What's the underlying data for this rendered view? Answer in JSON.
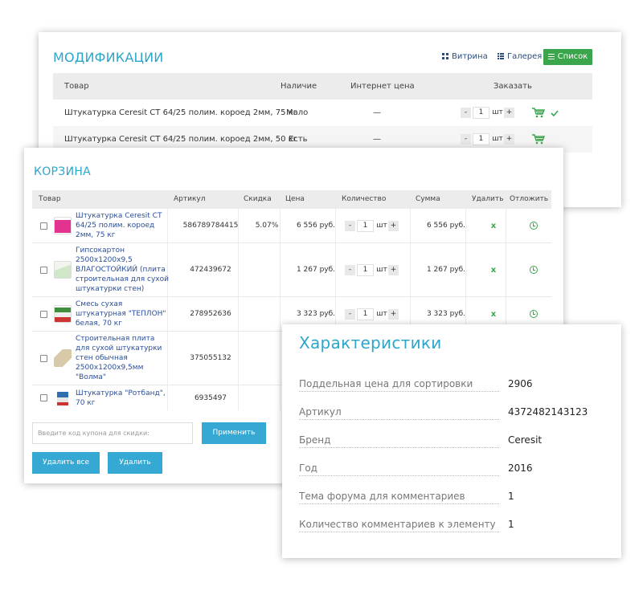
{
  "modifications": {
    "title": "МОДИФИКАЦИИ",
    "view_buttons": [
      {
        "label": "Витрина",
        "icon": "grid-icon"
      },
      {
        "label": "Галерея",
        "icon": "list-icon"
      },
      {
        "label": "Список",
        "icon": "menu-icon",
        "active": true
      }
    ],
    "columns": [
      "Товар",
      "Наличие",
      "Интернет цена",
      "Заказать"
    ],
    "rows": [
      {
        "name": "Штукатурка Ceresit CT 64/25 полим. короед 2мм, 75 кг",
        "availability": "Мало",
        "price": "—",
        "qty": "1",
        "unit": "шт",
        "in_cart": true
      },
      {
        "name": "Штукатурка Ceresit CT 64/25 полим. короед 2мм, 50 кг",
        "availability": "Есть",
        "price": "—",
        "qty": "1",
        "unit": "шт",
        "in_cart": false
      }
    ],
    "qty_minus": "-",
    "qty_plus": "+"
  },
  "cart": {
    "title": "КОРЗИНА",
    "columns": [
      "Товар",
      "Артикул",
      "Скидка",
      "Цена",
      "Количество",
      "Сумма",
      "Удалить",
      "Отложить"
    ],
    "rows": [
      {
        "name": "Штукатурка Ceresit CT 64/25 полим. короед 2мм, 75 кг",
        "sku": "586789784415",
        "discount": "5.07%",
        "price": "6 556 руб.",
        "qty": "1",
        "unit": "шт",
        "sum": "6 556 руб."
      },
      {
        "name": "Гипсокартон 2500x1200x9,5 ВЛАГОСТОЙКИЙ (плита строительная для сухой штукатурки стен)",
        "sku": "472439672",
        "discount": "",
        "price": "1 267 руб.",
        "qty": "1",
        "unit": "шт",
        "sum": "1 267 руб."
      },
      {
        "name": "Смесь сухая штукатурная \"ТЕПЛОН\" белая, 70 кг",
        "sku": "278952636",
        "discount": "",
        "price": "3 323 руб.",
        "qty": "1",
        "unit": "шт",
        "sum": "3 323 руб."
      },
      {
        "name": "Строительная плита для сухой штукатурки стен обычная 2500x1200x9,5мм \"Волма\"",
        "sku": "375055132",
        "discount": "",
        "price": "",
        "qty": "",
        "unit": "",
        "sum": ""
      },
      {
        "name": "Штукатурка \"Ротбанд\", 70 кг",
        "sku": "6935497",
        "discount": "",
        "price": "",
        "qty": "",
        "unit": "",
        "sum": ""
      }
    ],
    "delete_symbol": "x",
    "coupon_placeholder": "Введите код купона для скидки:",
    "apply_label": "Применить",
    "delete_all_label": "Удалить все",
    "delete_label": "Удалить"
  },
  "characteristics": {
    "title": "Характеристики",
    "props": [
      {
        "name": "Поддельная цена для сортировки",
        "value": "2906"
      },
      {
        "name": "Артикул",
        "value": "4372482143123"
      },
      {
        "name": "Бренд",
        "value": "Ceresit"
      },
      {
        "name": "Год",
        "value": "2016"
      },
      {
        "name": "Тема форума для комментариев",
        "value": "1"
      },
      {
        "name": "Количество комментариев к элементу",
        "value": "1"
      }
    ]
  },
  "colors": {
    "accent": "#2ba6cb",
    "green": "#3aa54a",
    "button_blue": "#35a8d3",
    "link": "#2a4d9a"
  }
}
